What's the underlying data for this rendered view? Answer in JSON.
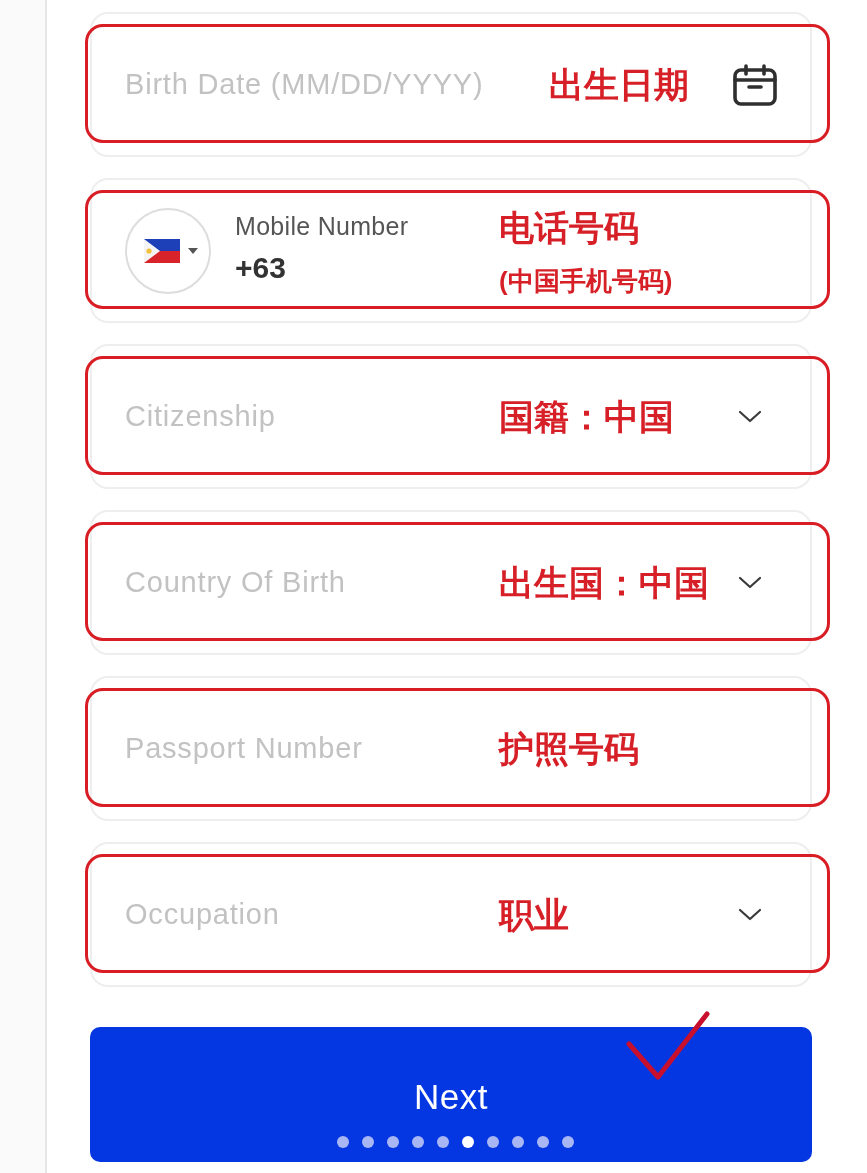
{
  "form": {
    "fields": [
      {
        "kind": "date",
        "placeholder": "Birth Date (MM/DD/YYYY)",
        "note": [
          "出生日期"
        ]
      },
      {
        "kind": "phone",
        "label": "Mobile Number",
        "value": "+63",
        "note": [
          "电话号码",
          "(中国手机号码)"
        ]
      },
      {
        "kind": "select",
        "placeholder": "Citizenship",
        "note": [
          "国籍：中国"
        ]
      },
      {
        "kind": "select",
        "placeholder": "Country Of Birth",
        "note": [
          "出生国：中国"
        ]
      },
      {
        "kind": "text",
        "placeholder": "Passport Number",
        "note": [
          "护照号码"
        ]
      },
      {
        "kind": "select",
        "placeholder": "Occupation",
        "note": [
          "职业"
        ]
      }
    ],
    "next_button": {
      "label": "Next"
    }
  },
  "page_indicator": [
    {
      "selected": false
    },
    {
      "selected": false
    },
    {
      "selected": false
    },
    {
      "selected": false
    },
    {
      "selected": false
    },
    {
      "selected": true
    },
    {
      "selected": false
    },
    {
      "selected": false
    },
    {
      "selected": false
    },
    {
      "selected": false
    }
  ]
}
